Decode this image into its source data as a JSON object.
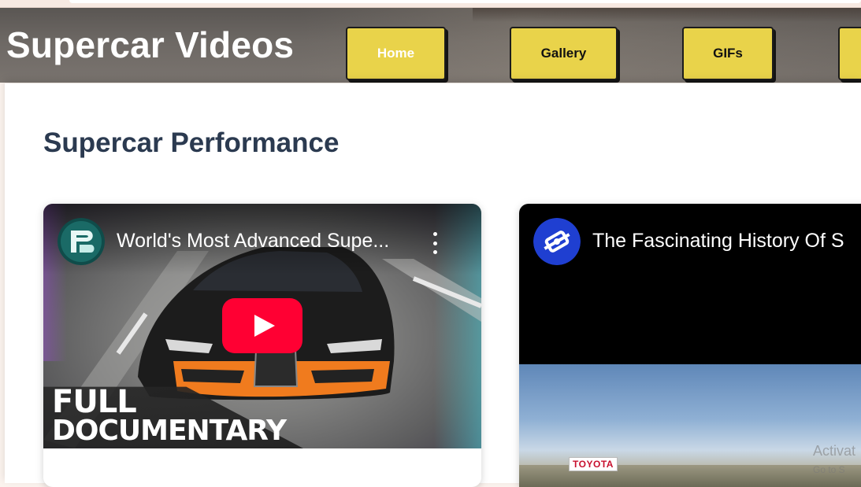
{
  "header": {
    "site_title": "Supercar Videos",
    "nav": [
      {
        "label": "Home",
        "active": true
      },
      {
        "label": "Gallery"
      },
      {
        "label": "GIFs"
      },
      {
        "label": ""
      }
    ],
    "accent_color": "#e9d34a"
  },
  "main": {
    "section_title": "Supercar Performance",
    "videos": [
      {
        "title": "World's Most Advanced Supe...",
        "channel_icon": "channel-avatar-icon",
        "overlay_line1": "FULL",
        "overlay_line2": "DOCUMENTARY",
        "play_icon": "youtube-play-icon"
      },
      {
        "title": "The Fascinating History Of S",
        "channel_icon": "channel-avatar-icon",
        "sign_text": "TOYOTA"
      }
    ]
  },
  "watermark": {
    "line1": "Activat",
    "line2": "Go to S"
  }
}
